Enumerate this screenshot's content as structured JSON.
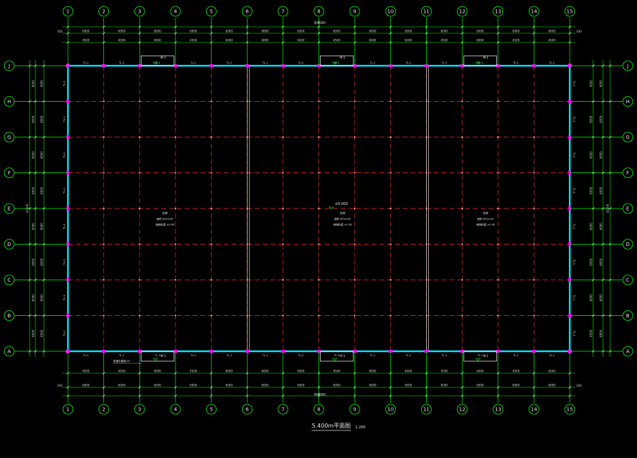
{
  "drawing": {
    "title": "5.400m平面图",
    "scale": "1:200",
    "overall_dim": "84660",
    "overall_dim_side": "43200",
    "elevation": "±0.000"
  },
  "grid": {
    "columns": [
      "1",
      "2",
      "3",
      "4",
      "5",
      "6",
      "7",
      "8",
      "9",
      "10",
      "11",
      "12",
      "13",
      "14",
      "15"
    ],
    "rows": [
      "J",
      "H",
      "G",
      "F",
      "E",
      "D",
      "C",
      "B",
      "A"
    ]
  },
  "dims": {
    "top_outer": [
      "6000",
      "6000",
      "6000",
      "6000",
      "6000",
      "6000",
      "6000",
      "6000",
      "6000",
      "6000",
      "6000",
      "6000",
      "6000",
      "6000"
    ],
    "top_inner": [
      "4500",
      "4500",
      "6000",
      "4500",
      "6000",
      "6000",
      "6000",
      "4500",
      "6000",
      "6000",
      "4500",
      "6000",
      "4500",
      "4500"
    ],
    "side_outer": [
      "6000",
      "6000",
      "6000",
      "6000",
      "6000",
      "6000",
      "6000",
      "6000"
    ],
    "side_inner": [
      "4500",
      "6000",
      "6000",
      "6000",
      "6000",
      "6000",
      "6000",
      "4500"
    ],
    "edge_offset": "330"
  },
  "zones": [
    {
      "name": "仓库",
      "line1": "面积 8750.00",
      "line2": "地面标高 ±0.00"
    },
    {
      "name": "仓库",
      "line1": "面积 8750.00",
      "line2": "地面标高 ±0.00"
    },
    {
      "name": "仓库",
      "line1": "面积 8750.00",
      "line2": "地面标高 ±0.00"
    }
  ],
  "labels": {
    "beam": "TL-1",
    "door": "M-1",
    "note": "坡道见建施-05"
  },
  "colors": {
    "background": "#000000",
    "axis": "#00ff00",
    "wall": "#00e5ff",
    "column": "#ff00ff",
    "grid_dash": "#c81e1e",
    "divider": "#ffffff",
    "text": "#e6e6e6",
    "dim_text": "#d8d8d8"
  }
}
